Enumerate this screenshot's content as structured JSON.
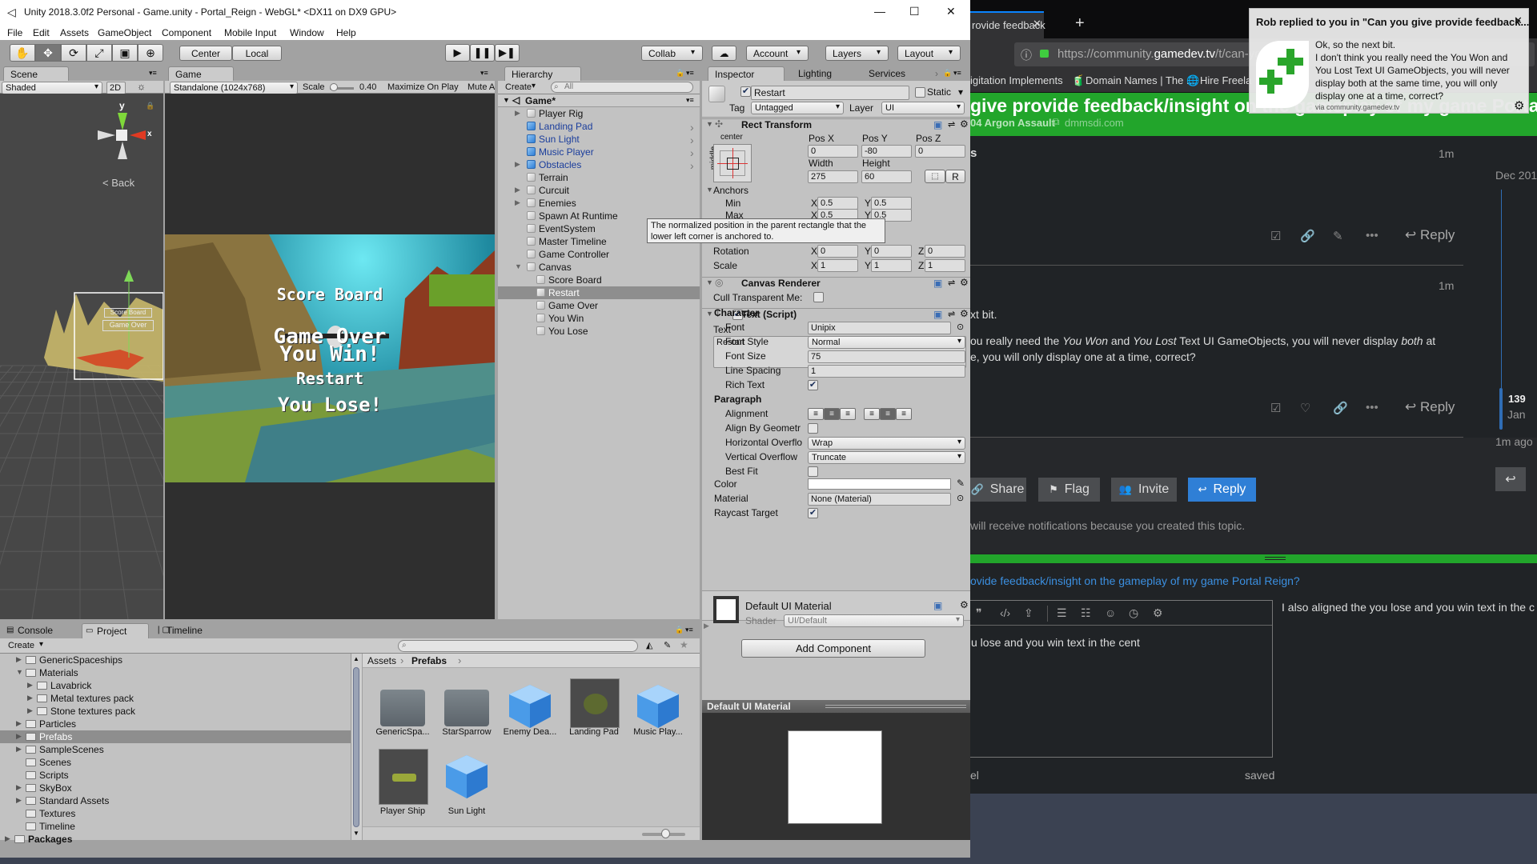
{
  "window": {
    "title": "Unity 2018.3.0f2 Personal - Game.unity - Portal_Reign - WebGL* <DX11 on DX9 GPU>",
    "controls": [
      "—",
      "☐",
      "✕"
    ]
  },
  "menu": [
    "File",
    "Edit",
    "Assets",
    "GameObject",
    "Component",
    "Mobile Input",
    "Window",
    "Help"
  ],
  "toolbar": {
    "tools": [
      "hand-icon",
      "move-icon",
      "rotate-icon",
      "scale-icon",
      "rect-tool-icon",
      "transform-icon"
    ],
    "tool_glyphs": [
      "✋",
      "✥",
      "⟳",
      "⤢",
      "▣",
      "⊕"
    ],
    "pivot": "Center",
    "space": "Local",
    "play_glyphs": [
      "▶",
      "❚❚",
      "▶❚"
    ],
    "collab": "Collab",
    "account": "Account",
    "layers": "Layers",
    "layout": "Layout"
  },
  "scene": {
    "tab": "Scene",
    "shading": "Shaded",
    "mode_2d": "2D",
    "axis_y": "y",
    "axis_x": "x",
    "back": "Back",
    "mini_labels": [
      "Score Board",
      "Game Over"
    ]
  },
  "game": {
    "tab": "Game",
    "resolution": "Standalone (1024x768)",
    "scale_label": "Scale",
    "scale_value": "0.40",
    "maximize": "Maximize On Play",
    "mute": "Mute A",
    "overlay": {
      "score": "Score Board",
      "game_over": "Game Over",
      "you_win": "You Win!",
      "restart": "Restart",
      "you_lose": "You Lose!"
    }
  },
  "hierarchy": {
    "tab": "Hierarchy",
    "create": "Create",
    "search_placeholder": "All",
    "scene": "Game*",
    "items": [
      {
        "label": "Player Rig",
        "depth": 0,
        "arrow": "right",
        "prefab": false
      },
      {
        "label": "Landing Pad",
        "depth": 0,
        "arrow": "",
        "prefab": true,
        "chevron": true
      },
      {
        "label": "Sun Light",
        "depth": 0,
        "arrow": "",
        "prefab": true,
        "chevron": true
      },
      {
        "label": "Music Player",
        "depth": 0,
        "arrow": "",
        "prefab": true,
        "chevron": true
      },
      {
        "label": "Obstacles",
        "depth": 0,
        "arrow": "right",
        "prefab": true,
        "chevron": true
      },
      {
        "label": "Terrain",
        "depth": 0,
        "arrow": "",
        "prefab": false
      },
      {
        "label": "Curcuit",
        "depth": 0,
        "arrow": "right",
        "prefab": false
      },
      {
        "label": "Enemies",
        "depth": 0,
        "arrow": "right",
        "prefab": false
      },
      {
        "label": "Spawn At Runtime",
        "depth": 0,
        "arrow": "",
        "prefab": false
      },
      {
        "label": "EventSystem",
        "depth": 0,
        "arrow": "",
        "prefab": false
      },
      {
        "label": "Master Timeline",
        "depth": 0,
        "arrow": "",
        "prefab": false
      },
      {
        "label": "Game Controller",
        "depth": 0,
        "arrow": "",
        "prefab": false
      },
      {
        "label": "Canvas",
        "depth": 0,
        "arrow": "down",
        "prefab": false
      },
      {
        "label": "Score Board",
        "depth": 1,
        "arrow": "",
        "prefab": false
      },
      {
        "label": "Restart",
        "depth": 1,
        "arrow": "",
        "prefab": false,
        "selected": true
      },
      {
        "label": "Game Over",
        "depth": 1,
        "arrow": "",
        "prefab": false
      },
      {
        "label": "You Win",
        "depth": 1,
        "arrow": "",
        "prefab": false
      },
      {
        "label": "You Lose",
        "depth": 1,
        "arrow": "",
        "prefab": false
      }
    ]
  },
  "inspector": {
    "tabs": [
      "Inspector",
      "Lighting",
      "Services"
    ],
    "object_name": "Restart",
    "active": true,
    "static_label": "Static",
    "static": false,
    "tag_label": "Tag",
    "tag": "Untagged",
    "layer_label": "Layer",
    "layer": "UI",
    "rect_transform": {
      "title": "Rect Transform",
      "anchor_preset_h": "center",
      "anchor_preset_v": "middle",
      "pos_x_label": "Pos X",
      "pos_y_label": "Pos Y",
      "pos_z_label": "Pos Z",
      "pos_x": "0",
      "pos_y": "-80",
      "pos_z": "0",
      "width_label": "Width",
      "height_label": "Height",
      "width": "275",
      "height": "60",
      "raw_button": "R",
      "anchors_label": "Anchors",
      "min_label": "Min",
      "min_x": "0.5",
      "min_y": "0.5",
      "max_label": "Max",
      "max_x": "0.5",
      "max_y": "0.5",
      "rotation_label": "Rotation",
      "rot_x": "0",
      "rot_y": "0",
      "rot_z": "0",
      "scale_label": "Scale",
      "scale_x": "1",
      "scale_y": "1",
      "scale_z": "1",
      "x": "X",
      "y": "Y",
      "z": "Z"
    },
    "tooltip": "The normalized position in the parent rectangle that the lower left corner is anchored to.",
    "canvas_renderer": {
      "title": "Canvas Renderer",
      "cull_label": "Cull Transparent Me:",
      "cull": false
    },
    "text_script": {
      "title": "Text (Script)",
      "enabled": true,
      "text_label": "Text",
      "text": "Restart",
      "character_label": "Character",
      "font_label": "Font",
      "font": "Unipix",
      "font_style_label": "Font Style",
      "font_style": "Normal",
      "font_size_label": "Font Size",
      "font_size": "75",
      "line_spacing_label": "Line Spacing",
      "line_spacing": "1",
      "rich_text_label": "Rich Text",
      "rich_text": true,
      "paragraph_label": "Paragraph",
      "alignment_label": "Alignment",
      "align_h": "center",
      "align_v": "middle",
      "align_geometry_label": "Align By Geometr",
      "align_geometry": false,
      "h_overflow_label": "Horizontal Overflo",
      "h_overflow": "Wrap",
      "v_overflow_label": "Vertical Overflow",
      "v_overflow": "Truncate",
      "best_fit_label": "Best Fit",
      "best_fit": false,
      "color_label": "Color",
      "color": "#ffffff",
      "material_label": "Material",
      "material": "None (Material)",
      "raycast_label": "Raycast Target",
      "raycast": true
    },
    "material": {
      "name": "Default UI Material",
      "shader_label": "Shader",
      "shader": "UI/Default"
    },
    "add_component": "Add Component",
    "preview_title": "Default UI Material"
  },
  "bottom_tabs": [
    "Console",
    "Project",
    "Timeline"
  ],
  "project": {
    "create": "Create",
    "tree": [
      {
        "label": "GenericSpaceships",
        "depth": 0,
        "arrow": "right"
      },
      {
        "label": "Materials",
        "depth": 0,
        "arrow": "down"
      },
      {
        "label": "Lavabrick",
        "depth": 1,
        "arrow": "right"
      },
      {
        "label": "Metal textures pack",
        "depth": 1,
        "arrow": "right"
      },
      {
        "label": "Stone textures pack",
        "depth": 1,
        "arrow": "right"
      },
      {
        "label": "Particles",
        "depth": 0,
        "arrow": "right"
      },
      {
        "label": "Prefabs",
        "depth": 0,
        "arrow": "right",
        "selected": true
      },
      {
        "label": "SampleScenes",
        "depth": 0,
        "arrow": "right"
      },
      {
        "label": "Scenes",
        "depth": 0,
        "arrow": ""
      },
      {
        "label": "Scripts",
        "depth": 0,
        "arrow": ""
      },
      {
        "label": "SkyBox",
        "depth": 0,
        "arrow": "right"
      },
      {
        "label": "Standard Assets",
        "depth": 0,
        "arrow": "right"
      },
      {
        "label": "Textures",
        "depth": 0,
        "arrow": ""
      },
      {
        "label": "Timeline",
        "depth": 0,
        "arrow": ""
      },
      {
        "label": "Packages",
        "depth": -1,
        "arrow": "right",
        "bold": true
      }
    ],
    "breadcrumb": [
      "Assets",
      "Prefabs"
    ],
    "assets": [
      {
        "label": "GenericSpa...",
        "kind": "folder"
      },
      {
        "label": "StarSparrow",
        "kind": "folder"
      },
      {
        "label": "Enemy Dea...",
        "kind": "prefab"
      },
      {
        "label": "Landing Pad",
        "kind": "model"
      },
      {
        "label": "Music Play...",
        "kind": "prefab"
      },
      {
        "label": "Player Ship",
        "kind": "model"
      },
      {
        "label": "Sun Light",
        "kind": "prefab"
      }
    ]
  },
  "browser": {
    "tab_title": "rovide feedback",
    "url_prefix": "https://community.",
    "url_domain": "gamedev.tv",
    "url_suffix": "/t/can-yo",
    "bookmarks": [
      "igitation Implements",
      "Domain Names | The ...",
      "Hire Freela"
    ],
    "topic_title": "give provide feedback/insight on the gameplay of my game Portal Reign",
    "category": "04 Argon Assault",
    "site": "dmmsdi.com",
    "post1": {
      "fragment": "s",
      "time": "1m",
      "reply": "Reply"
    },
    "post2": {
      "time": "1m",
      "line1": "xt bit.",
      "p_a": "ou really need the ",
      "p_em1": "You Won",
      "p_b": " and ",
      "p_em2": "You Lost",
      "p_c": " Text UI GameObjects, you will never display ",
      "p_em3": "both",
      "p_d": " at",
      "line3": "e, you will only display one at a time, correct?",
      "reply": "Reply"
    },
    "timeline": {
      "date_top": "Dec 201",
      "count": "139",
      "date_bottom": "Jan",
      "ago": "1m ago"
    },
    "buttons": {
      "share": "Share",
      "flag": "Flag",
      "invite": "Invite",
      "reply": "Reply"
    },
    "notification_text": "will receive notifications because you created this topic.",
    "composer": {
      "link": "ovide feedback/insight on the gameplay of my game Portal Reign?",
      "editor_text": "u lose and you win text in the cent",
      "preview_text": "I also aligned the you lose and you win text in the c",
      "cancel_fragment": "el",
      "status": "saved"
    },
    "accent": "#22a52b",
    "reply_blue": "#2f7fd6"
  },
  "notification": {
    "title": "Rob replied to you in \"Can you give provide feedback...",
    "lines": [
      "Ok, so the next bit.",
      "I don't think you really need the You Won and",
      "You Lost Text UI GameObjects, you will never",
      "display both at the same time, you will only",
      "display one at a time, correct?"
    ],
    "source": "via community.gamedev.tv",
    "close": "✕"
  }
}
